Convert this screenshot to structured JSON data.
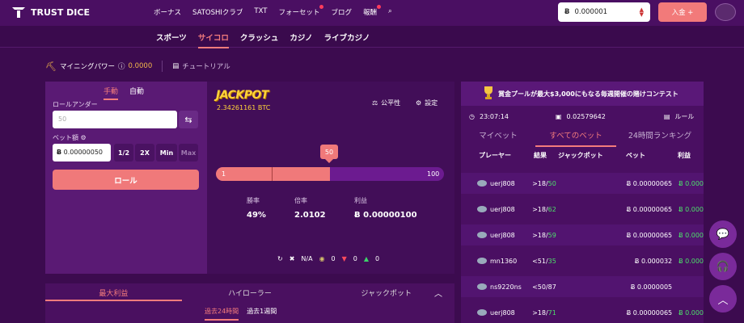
{
  "header": {
    "logo_text": "TRUST DICE",
    "nav": [
      "ボーナス",
      "SATOSHIクラブ",
      "TXT",
      "フォーセット",
      "ブログ",
      "報酬"
    ],
    "balance_currency": "Ƀ",
    "balance_value": "0.000001",
    "deposit_label": "入金 +"
  },
  "subnav": [
    "スポーツ",
    "サイコロ",
    "クラッシュ",
    "カジノ",
    "ライブカジノ"
  ],
  "mining": {
    "label": "マイニングパワー",
    "value": "0.0000",
    "tutorial": "チュートリアル"
  },
  "bet": {
    "tab_manual": "手動",
    "tab_auto": "自動",
    "roll_under_label": "ロールアンダー",
    "roll_under_placeholder": "50",
    "bet_amount_label": "ベット額",
    "bet_currency": "Ƀ",
    "bet_value": "0.00000050",
    "quick": [
      "1/2",
      "2X",
      "Min",
      "Max"
    ],
    "roll_label": "ロール"
  },
  "board": {
    "jackpot_title": "JACKPOT",
    "jackpot_value": "2.34261161 BTC",
    "fair_label": "公平性",
    "settings_label": "設定",
    "slider_min": "1",
    "slider_max": "100",
    "slider_value": "50",
    "slider_level": 0.5,
    "win_chance_label": "勝率",
    "win_chance_value": "49%",
    "payout_label": "倍率",
    "payout_value": "2.0102",
    "profit_label": "利益",
    "profit_value": "Ƀ 0.00000100",
    "bottom": {
      "na": "N/A",
      "c1": "0",
      "c2": "0",
      "c3": "0"
    }
  },
  "lower": {
    "tabs": [
      "最大利益",
      "ハイローラー",
      "ジャックポット"
    ],
    "sub": [
      "過去24時間",
      "過去1週間"
    ]
  },
  "right": {
    "contest": "賞金プールが最大$3,000にもなる毎週開催の賭けコンテスト",
    "time": "23:07:14",
    "amount": "0.02579642",
    "rules": "ルール",
    "tabs": [
      "マイベット",
      "すべてのベット",
      "24時間ランキング"
    ],
    "headers": [
      "プレーヤー",
      "結果",
      "ジャックポット",
      "ベット",
      "利益"
    ],
    "rows": [
      {
        "user": "uerj808",
        "res_a": ">18/",
        "res_b": "50",
        "bet": "Ƀ 0.00000065",
        "profit": "Ƀ 0.000"
      },
      {
        "user": "uerj808",
        "res_a": ">18/",
        "res_b": "62",
        "bet": "Ƀ 0.00000065",
        "profit": "Ƀ 0.000"
      },
      {
        "user": "uerj808",
        "res_a": ">18/",
        "res_b": "59",
        "bet": "Ƀ 0.00000065",
        "profit": "Ƀ 0.000"
      },
      {
        "user": "mn1360",
        "res_a": "<51/",
        "res_b": "35",
        "bet": "Ƀ 0.000032",
        "profit": "Ƀ 0.000"
      },
      {
        "user": "ns9220ns",
        "res_a": "<50/87",
        "res_b": "",
        "bet": "Ƀ 0.0000005",
        "profit": ""
      },
      {
        "user": "uerj808",
        "res_a": ">18/",
        "res_b": "71",
        "bet": "Ƀ 0.00000065",
        "profit": "Ƀ 0.000"
      }
    ]
  }
}
